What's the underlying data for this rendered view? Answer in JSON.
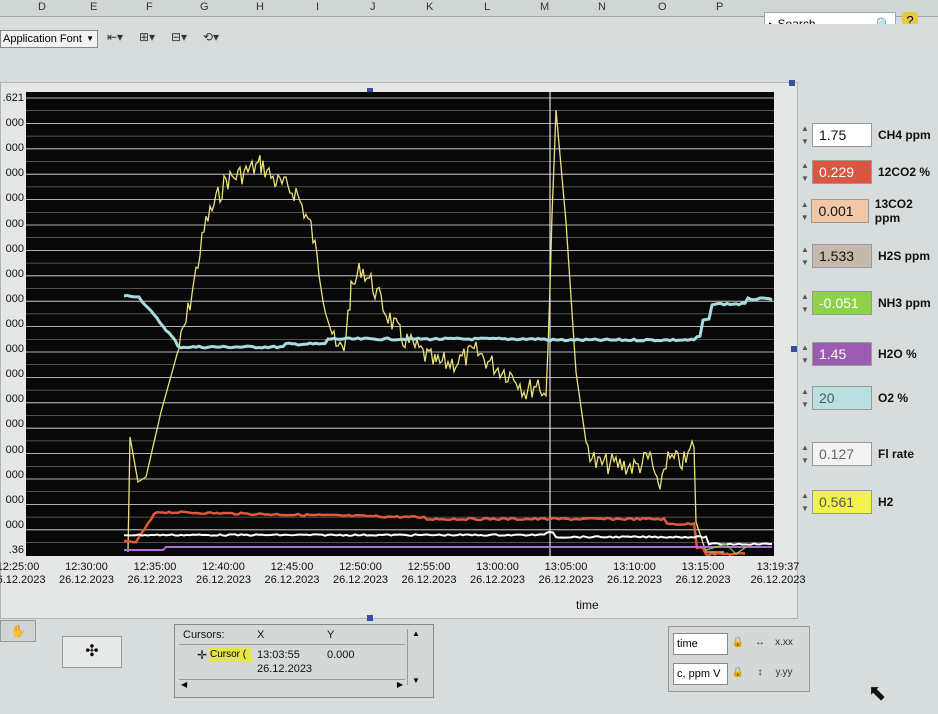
{
  "spreadsheet_columns": [
    "D",
    "E",
    "F",
    "G",
    "H",
    "I",
    "J",
    "K",
    "L",
    "M",
    "N",
    "O",
    "P"
  ],
  "toolbar": {
    "font_select": "Application Font",
    "search_placeholder": "Search"
  },
  "graph": {
    "y_tick_labels": [
      ".621",
      "000",
      "000",
      "000",
      "000",
      "000",
      "000",
      "000",
      "000",
      "000",
      "000",
      "000",
      "000",
      "000",
      "000",
      "000",
      "000",
      "000",
      ".36"
    ],
    "x_ticks": [
      {
        "time": "12:25:00",
        "date": "26.12.2023"
      },
      {
        "time": "12:30:00",
        "date": "26.12.2023"
      },
      {
        "time": "12:35:00",
        "date": "26.12.2023"
      },
      {
        "time": "12:40:00",
        "date": "26.12.2023"
      },
      {
        "time": "12:45:00",
        "date": "26.12.2023"
      },
      {
        "time": "12:50:00",
        "date": "26.12.2023"
      },
      {
        "time": "12:55:00",
        "date": "26.12.2023"
      },
      {
        "time": "13:00:00",
        "date": "26.12.2023"
      },
      {
        "time": "13:05:00",
        "date": "26.12.2023"
      },
      {
        "time": "13:10:00",
        "date": "26.12.2023"
      },
      {
        "time": "13:15:00",
        "date": "26.12.2023"
      },
      {
        "time": "13:19:37",
        "date": "26.12.2023"
      }
    ],
    "x_axis_label": "time"
  },
  "legend": [
    {
      "value": "1.75",
      "label": "CH4 ppm",
      "color": "#ffffff",
      "text_color": "#111111"
    },
    {
      "value": "0.229",
      "label": "12CO2 %",
      "color": "#d9573f",
      "text_color": "#ffffff"
    },
    {
      "value": "0.001",
      "label": "13CO2 ppm",
      "color": "#f0c8a8",
      "text_color": "#111111"
    },
    {
      "value": "1.533",
      "label": "H2S  ppm",
      "color": "#c4b9ab",
      "text_color": "#111111"
    },
    {
      "value": "-0.051",
      "label": "NH3 ppm",
      "color": "#8ed24a",
      "text_color": "#ffffff"
    },
    {
      "value": "1.45",
      "label": "H2O  %",
      "color": "#9a5bb0",
      "text_color": "#ffffff"
    },
    {
      "value": "20",
      "label": "O2 %",
      "color": "#b8e0e0",
      "text_color": "#555555"
    },
    {
      "value": "0.127",
      "label": "Fl rate",
      "color": "#f3f3f3",
      "text_color": "#666666"
    },
    {
      "value": "0.561",
      "label": "H2",
      "color": "#f2f24a",
      "text_color": "#555555"
    }
  ],
  "cursors": {
    "header_name": "Cursors:",
    "header_x": "X",
    "header_y": "Y",
    "cursor_name": "Cursor (",
    "x_time": "13:03:55",
    "x_date": "26.12.2023",
    "y_value": "0.000"
  },
  "scale_panel": {
    "x_field": "time",
    "y_field": "c, ppm V"
  }
}
